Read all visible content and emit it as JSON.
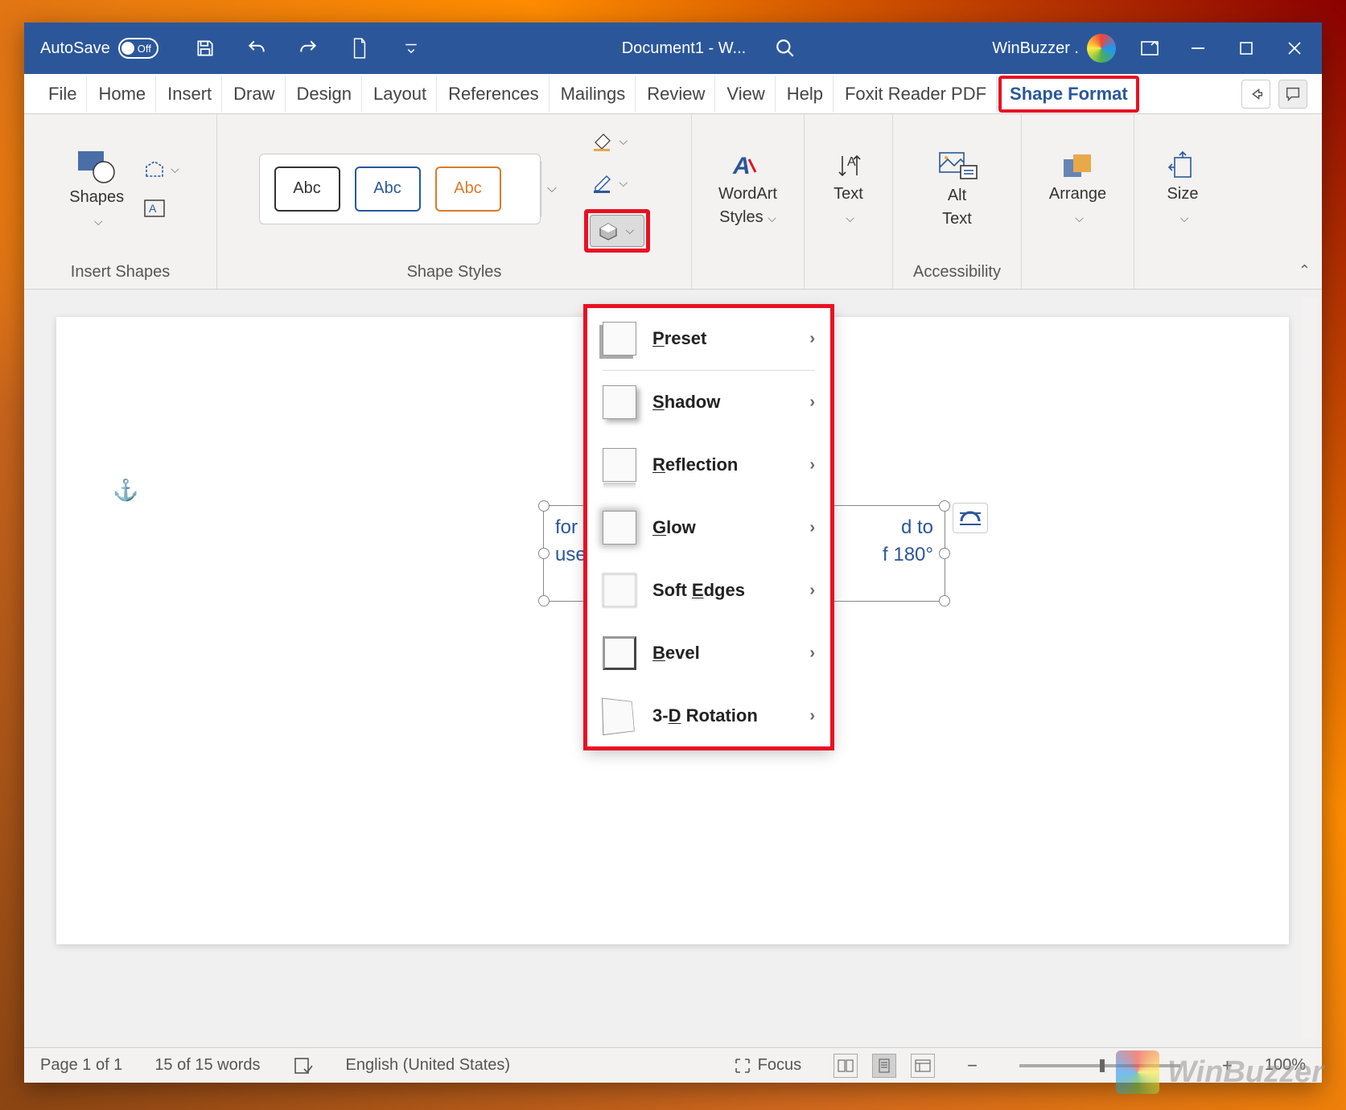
{
  "titlebar": {
    "autosave_label": "AutoSave",
    "autosave_state": "Off",
    "doc_title": "Document1  -  W...",
    "user_name": "WinBuzzer ."
  },
  "tabs": {
    "file": "File",
    "home": "Home",
    "insert": "Insert",
    "draw": "Draw",
    "design": "Design",
    "layout": "Layout",
    "references": "References",
    "mailings": "Mailings",
    "review": "Review",
    "view": "View",
    "help": "Help",
    "foxit": "Foxit Reader PDF",
    "shape_format": "Shape Format"
  },
  "ribbon": {
    "shapes_label": "Shapes",
    "insert_shapes_group": "Insert Shapes",
    "shape_styles_group": "Shape Styles",
    "style_sample": "Abc",
    "wordart_label": "WordArt",
    "wordart_sub": "Styles",
    "text_label": "Text",
    "alt_label": "Alt",
    "alt_sub": "Text",
    "accessibility_group": "Accessibility",
    "arrange_label": "Arrange",
    "size_label": "Size"
  },
  "effects_menu": {
    "preset": "Preset",
    "shadow": "Shadow",
    "reflection": "Reflection",
    "glow": "Glow",
    "soft_edges": "Soft Edges",
    "bevel": "Bevel",
    "rotation": "3-D Rotation"
  },
  "document": {
    "textbox_line1": "for u",
    "textbox_line1b": "d to",
    "textbox_line2": "use",
    "textbox_line2b": "f 180°"
  },
  "statusbar": {
    "page": "Page 1 of 1",
    "words": "15 of 15 words",
    "language": "English (United States)",
    "focus": "Focus",
    "zoom": "100%"
  },
  "watermark": "WinBuzzer"
}
